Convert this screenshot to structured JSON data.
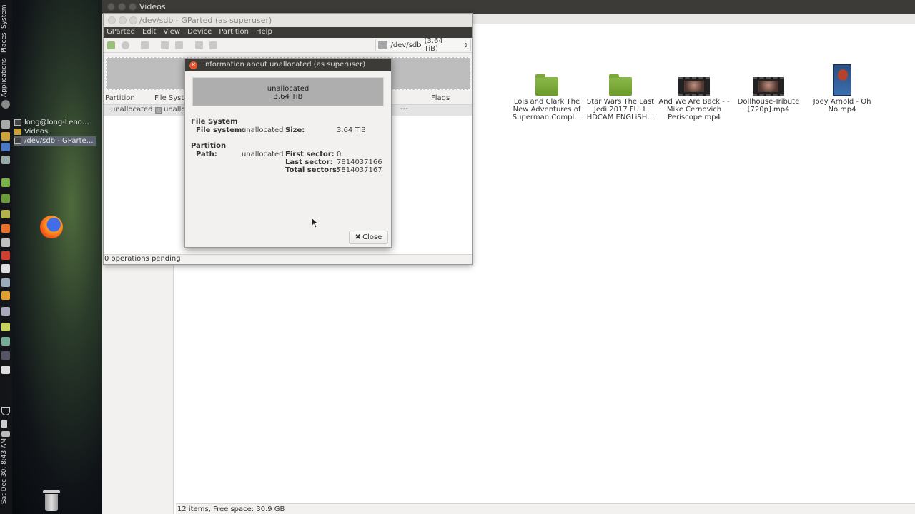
{
  "desktop": {
    "panel_labels": {
      "system": "System",
      "places": "Places",
      "applications": "Applications"
    },
    "clock": "Sat Dec 30, 8:43 AM",
    "window_list": [
      {
        "label": "long@long-Leno…",
        "active": false
      },
      {
        "label": "Videos",
        "active": false
      },
      {
        "label": "/dev/sdb - GParte…",
        "active": true
      }
    ]
  },
  "file_manager": {
    "title": "Videos",
    "files": [
      {
        "name": "Lois and Clark The New Adventures of Superman.Compl…",
        "icon": "folder-icon"
      },
      {
        "name": "Star Wars The Last Jedi 2017 FULL HDCAM ENGLiSH…",
        "icon": "folder-icon"
      },
      {
        "name": "And We Are Back - - Mike Cernovich Periscope.mp4",
        "icon": "video-thumbnail-icon"
      },
      {
        "name": "Dollhouse-Tribute [720p].mp4",
        "icon": "video-thumbnail-icon"
      },
      {
        "name": "Joey Arnold - Oh No.mp4",
        "icon": "video-portrait-icon"
      }
    ],
    "status": "12 items, Free space: 30.9 GB"
  },
  "gparted": {
    "title": "/dev/sdb - GParted (as superuser)",
    "menu": [
      "GParted",
      "Edit",
      "View",
      "Device",
      "Partition",
      "Help"
    ],
    "device": {
      "name": "/dev/sdb",
      "size": "(3.64 TiB)"
    },
    "columns": {
      "partition": "Partition",
      "filesystem": "File Syste",
      "flags": "Flags"
    },
    "row": {
      "partition": "unallocated",
      "filesystem": "unallo",
      "flags": "---"
    },
    "status": "0 operations pending"
  },
  "dialog": {
    "title": "Information about unallocated (as superuser)",
    "bar_line1": "unallocated",
    "bar_line2": "3.64 TiB",
    "fs_section": "File System",
    "fs_label": "File system:",
    "fs_value": "unallocated",
    "size_label": "Size:",
    "size_value": "3.64 TiB",
    "partition_section": "Partition",
    "path_label": "Path:",
    "path_value": "unallocated",
    "first_sector_label": "First sector:",
    "first_sector_value": "0",
    "last_sector_label": "Last sector:",
    "last_sector_value": "7814037166",
    "total_sectors_label": "Total sectors:",
    "total_sectors_value": "7814037167",
    "close_label": "Close"
  }
}
